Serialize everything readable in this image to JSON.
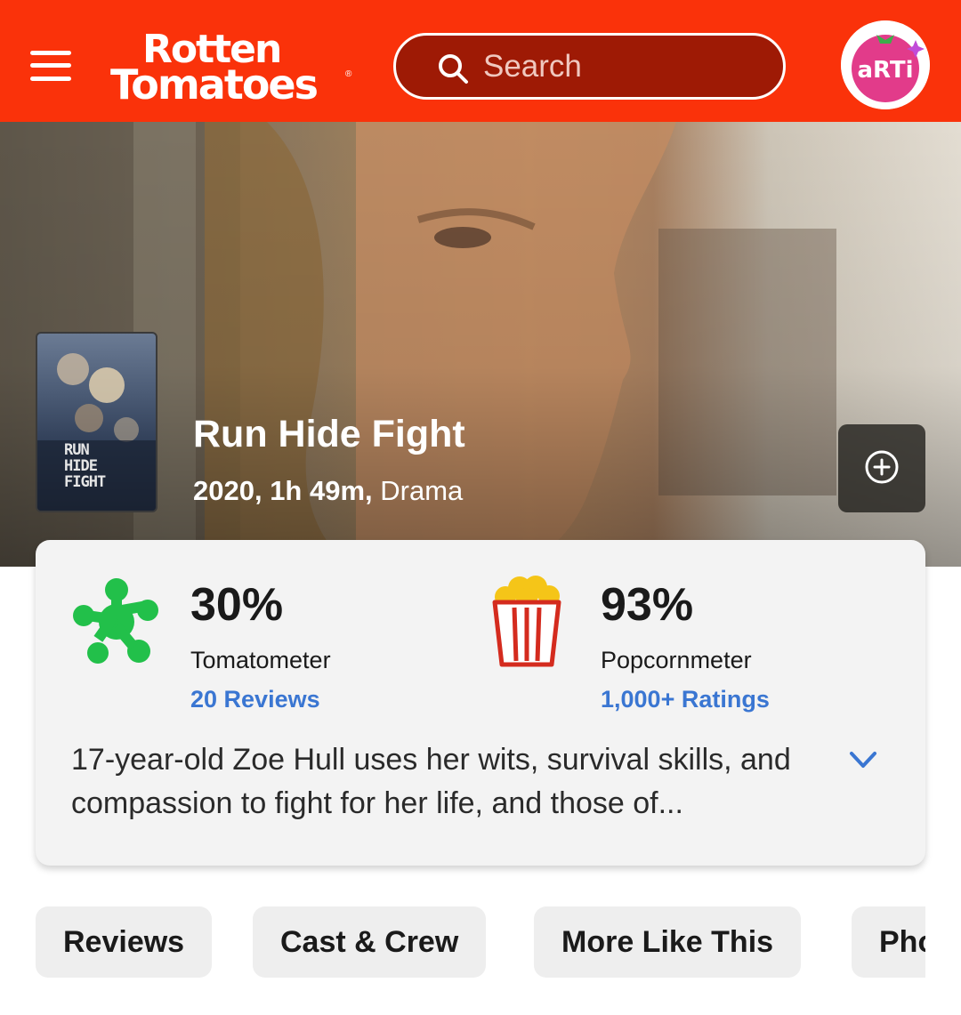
{
  "header": {
    "logo_line1": "Rotten",
    "logo_line2": "Tomatoes",
    "logo_reg": "®",
    "search_placeholder": "Search",
    "avatar_text": "aRTi"
  },
  "movie": {
    "title": "Run Hide Fight",
    "year_runtime": "2020, 1h 49m,",
    "genre": "Drama",
    "poster_text": "RUN\nHIDE\nFIGHT"
  },
  "scores": {
    "tomatometer": {
      "value": "30%",
      "label": "Tomatometer",
      "link": "20 Reviews",
      "color": "#22c04a"
    },
    "popcornmeter": {
      "value": "93%",
      "label": "Popcornmeter",
      "link": "1,000+ Ratings",
      "color": "#d42b1e"
    }
  },
  "synopsis": "17-year-old Zoe Hull uses her wits, survival skills, and compassion to fight for her life, and those of...",
  "tabs": [
    {
      "label": "Reviews"
    },
    {
      "label": "Cast & Crew"
    },
    {
      "label": "More Like This"
    },
    {
      "label": "Photos"
    }
  ],
  "colors": {
    "brand": "#fa320a",
    "link": "#3a76d2"
  },
  "icons": {
    "menu": "hamburger-icon",
    "search": "search-icon",
    "add": "plus-circle-icon",
    "expand": "chevron-down-icon",
    "tomatometer": "green-splat-icon",
    "popcornmeter": "popcorn-bucket-icon"
  }
}
